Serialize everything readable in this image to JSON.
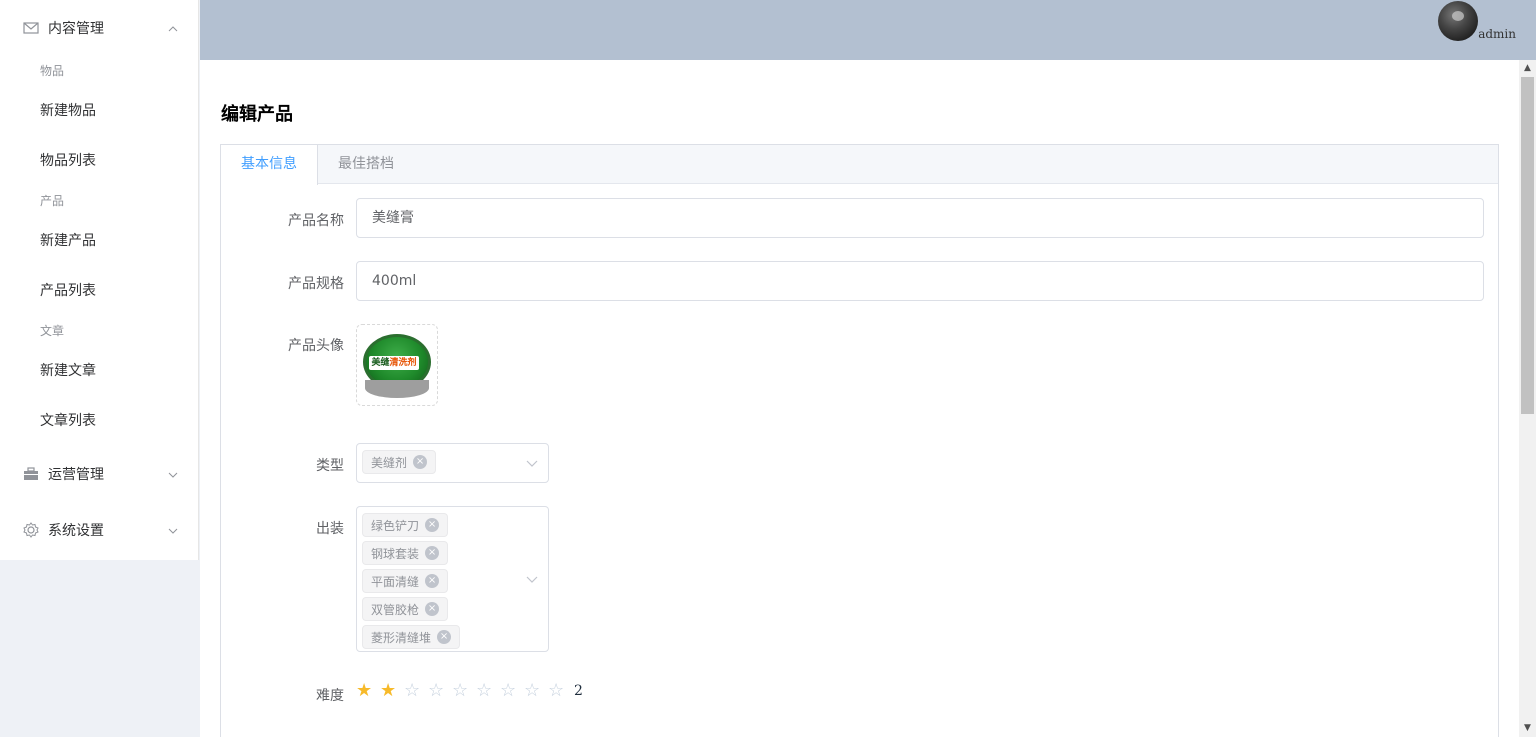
{
  "sidebar": {
    "content_menu": {
      "label": "内容管理",
      "icon": "mail-icon"
    },
    "groups": [
      {
        "title": "物品",
        "items": [
          "新建物品",
          "物品列表"
        ]
      },
      {
        "title": "产品",
        "items": [
          "新建产品",
          "产品列表"
        ]
      },
      {
        "title": "文章",
        "items": [
          "新建文章",
          "文章列表"
        ]
      }
    ],
    "ops_menu": {
      "label": "运营管理",
      "icon": "briefcase-icon"
    },
    "settings_menu": {
      "label": "系统设置",
      "icon": "gear-icon"
    }
  },
  "header": {
    "username": "admin"
  },
  "page": {
    "title": "编辑产品"
  },
  "tabs": [
    "基本信息",
    "最佳搭档"
  ],
  "form": {
    "name": {
      "label": "产品名称",
      "value": "美缝膏"
    },
    "spec": {
      "label": "产品规格",
      "value": "400ml"
    },
    "avatar": {
      "label": "产品头像",
      "image_text_a": "美缝",
      "image_text_b": "清洗剂"
    },
    "type": {
      "label": "类型",
      "tags": [
        "美缝剂"
      ]
    },
    "outfit": {
      "label": "出装",
      "tags": [
        "绿色铲刀",
        "钢球套装",
        "平面清缝",
        "双管胶枪",
        "菱形清缝堆"
      ]
    },
    "difficulty": {
      "label": "难度",
      "value": 2,
      "max": 9,
      "text": "2"
    }
  },
  "colors": {
    "accent": "#409eff",
    "header_bg": "#b3c0d1",
    "star_on": "#f7ba2a",
    "star_off": "#c6d1de"
  }
}
